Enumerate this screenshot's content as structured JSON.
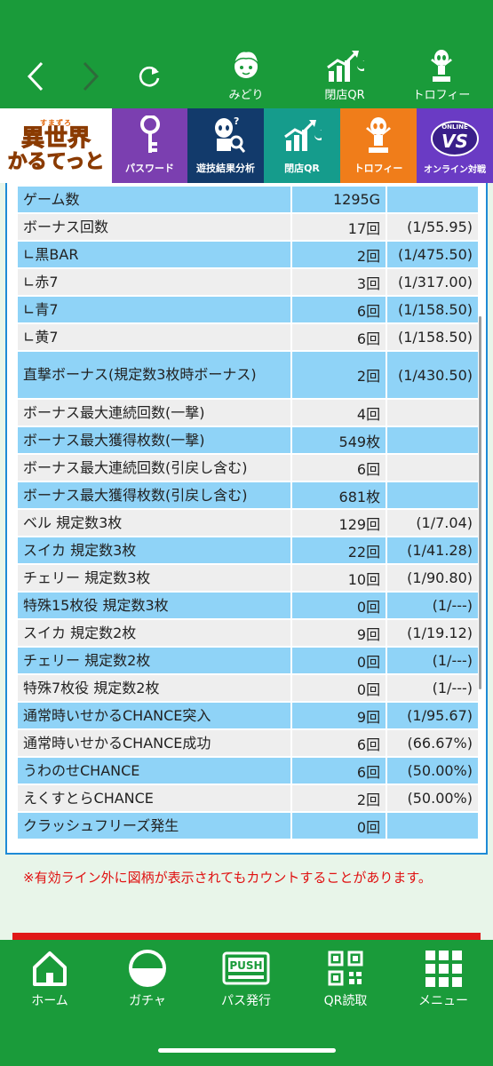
{
  "header": {
    "items": [
      {
        "label": "みどり",
        "icon": "character-face-icon"
      },
      {
        "label": "閉店QR",
        "icon": "chart-moon-icon"
      },
      {
        "label": "トロフィー",
        "icon": "trophy-figure-icon"
      }
    ]
  },
  "tabs": {
    "logo": {
      "small": "すまずろ",
      "line1": "異世界",
      "line2": "かるてっと"
    },
    "items": [
      {
        "label": "パスワード",
        "color": "#7b3fb0",
        "icon": "key-icon"
      },
      {
        "label": "遊技結果分析",
        "color": "#123a6b",
        "icon": "analysis-figure-icon"
      },
      {
        "label": "閉店QR",
        "color": "#159c8c",
        "icon": "chart-moon-icon"
      },
      {
        "label": "トロフィー",
        "color": "#f07d1a",
        "icon": "trophy-figure-icon"
      },
      {
        "label": "オンライン対戦",
        "color": "#6a3bc4",
        "icon": "vs-icon",
        "badge": "VS",
        "badge_top": "ONLINE"
      }
    ]
  },
  "stats": {
    "rows": [
      {
        "label": "ゲーム数",
        "value": "1295G",
        "rate": ""
      },
      {
        "label": "ボーナス回数",
        "value": "17回",
        "rate": "(1/55.95)"
      },
      {
        "label": "∟黒BAR",
        "value": "2回",
        "rate": "(1/475.50)"
      },
      {
        "label": "∟赤7",
        "value": "3回",
        "rate": "(1/317.00)"
      },
      {
        "label": "∟青7",
        "value": "6回",
        "rate": "(1/158.50)"
      },
      {
        "label": "∟黄7",
        "value": "6回",
        "rate": "(1/158.50)"
      },
      {
        "label": "直撃ボーナス(規定数3枚時ボーナス)",
        "value": "2回",
        "rate": "(1/430.50)"
      },
      {
        "label": "ボーナス最大連続回数(一撃)",
        "value": "4回",
        "rate": ""
      },
      {
        "label": "ボーナス最大獲得枚数(一撃)",
        "value": "549枚",
        "rate": ""
      },
      {
        "label": "ボーナス最大連続回数(引戻し含む)",
        "value": "6回",
        "rate": ""
      },
      {
        "label": "ボーナス最大獲得枚数(引戻し含む)",
        "value": "681枚",
        "rate": ""
      },
      {
        "label": "ベル 規定数3枚",
        "value": "129回",
        "rate": "(1/7.04)"
      },
      {
        "label": "スイカ 規定数3枚",
        "value": "22回",
        "rate": "(1/41.28)"
      },
      {
        "label": "チェリー 規定数3枚",
        "value": "10回",
        "rate": "(1/90.80)"
      },
      {
        "label": "特殊15枚役 規定数3枚",
        "value": "0回",
        "rate": "(1/---)"
      },
      {
        "label": "スイカ 規定数2枚",
        "value": "9回",
        "rate": "(1/19.12)"
      },
      {
        "label": "チェリー 規定数2枚",
        "value": "0回",
        "rate": "(1/---)"
      },
      {
        "label": "特殊7枚役 規定数2枚",
        "value": "0回",
        "rate": "(1/---)"
      },
      {
        "label": "通常時いせかるCHANCE突入",
        "value": "9回",
        "rate": "(1/95.67)"
      },
      {
        "label": "通常時いせかるCHANCE成功",
        "value": "6回",
        "rate": "(66.67%)"
      },
      {
        "label": "うわのせCHANCE",
        "value": "6回",
        "rate": "(50.00%)"
      },
      {
        "label": "えくすとらCHANCE",
        "value": "2回",
        "rate": "(50.00%)"
      },
      {
        "label": "クラッシュフリーズ発生",
        "value": "0回",
        "rate": ""
      }
    ],
    "notice": "※有効ライン外に図柄が表示されてもカウントすることがあります。"
  },
  "bottom_nav": {
    "items": [
      {
        "label": "ホーム",
        "icon": "home-icon"
      },
      {
        "label": "ガチャ",
        "icon": "gacha-ball-icon"
      },
      {
        "label": "パス発行",
        "icon": "push-icon",
        "badge": "PUSH"
      },
      {
        "label": "QR読取",
        "icon": "qr-code-icon"
      },
      {
        "label": "メニュー",
        "icon": "grid-menu-icon"
      }
    ]
  },
  "colors": {
    "brand_green": "#1a9b3a",
    "row_blue": "#8fd3f7",
    "row_grey": "#eeeeee",
    "notice_red": "#e01010"
  }
}
